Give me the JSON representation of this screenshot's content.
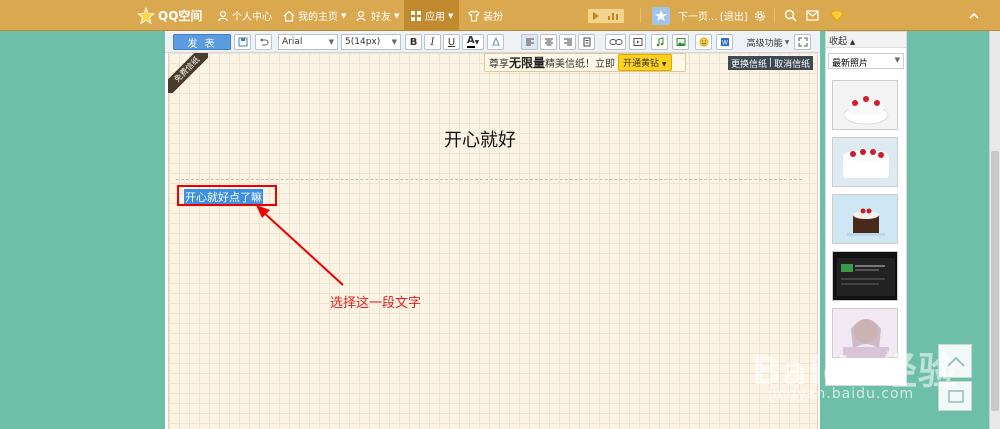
{
  "nav": {
    "logo_text": "QQ空间",
    "personal_center": "个人中心",
    "home": "我的主页",
    "friends": "好友",
    "apps": "应用",
    "dressup": "装扮",
    "next_page": "下一页...",
    "logout": "[退出]"
  },
  "toolbar": {
    "publish": "发 表",
    "font": "Arial",
    "size": "5(14px)",
    "bold": "B",
    "italic": "I",
    "underline": "U",
    "font_color": "A",
    "advanced": "高级功能"
  },
  "promo": {
    "prefix": "尊享",
    "highlight": "无限量",
    "suffix": "精美信纸！立即",
    "button": "开通黄钻",
    "ribbon": "免费信纸"
  },
  "paper_actions": {
    "change": "更换信纸",
    "separator": "|",
    "cancel": "取消信纸"
  },
  "document": {
    "title": "开心就好",
    "selected_text": "开心就好点了嘛"
  },
  "annotation": {
    "text": "选择这一段文字"
  },
  "sidebar": {
    "collapse_label": "收起",
    "album_select": "最新照片"
  },
  "watermark": {
    "brand": "Baidu经验",
    "url": "jingyan.baidu.com"
  },
  "colors": {
    "nav_bg": "#d9a84f",
    "page_bg": "#6dbfa8",
    "annotation": "#e00000",
    "selection": "#3d8fe0"
  }
}
